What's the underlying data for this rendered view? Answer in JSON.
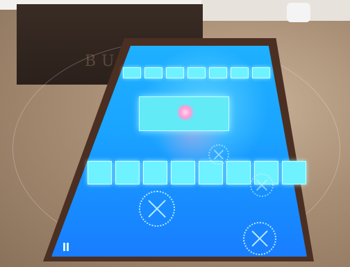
{
  "scene": {
    "box_brand_text": "BU",
    "colors": {
      "screen": "#1aa4ff",
      "tile": "#6ff2ff",
      "frame": "#4b2f22",
      "table": "#a88e74",
      "box": "#2b201b"
    },
    "tiles_top_row_count": 7,
    "tiles_bottom_row_count": 8,
    "icons": [
      "snowflake-icon",
      "menu-icon",
      "flower-glow-icon"
    ]
  }
}
